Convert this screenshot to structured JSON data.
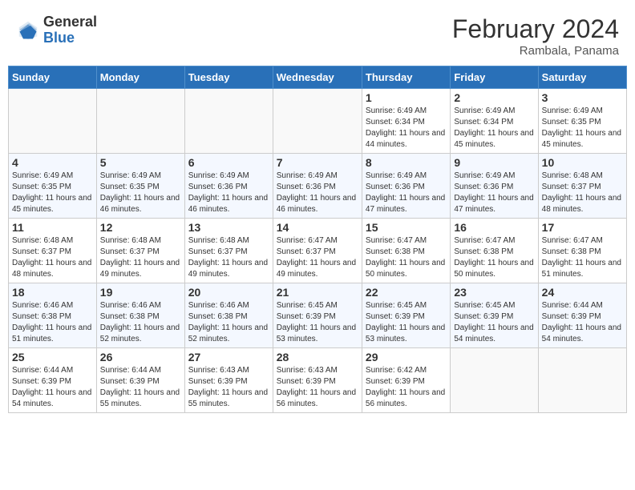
{
  "header": {
    "logo_general": "General",
    "logo_blue": "Blue",
    "month_title": "February 2024",
    "subtitle": "Rambala, Panama"
  },
  "days_of_week": [
    "Sunday",
    "Monday",
    "Tuesday",
    "Wednesday",
    "Thursday",
    "Friday",
    "Saturday"
  ],
  "weeks": [
    [
      {
        "day": "",
        "info": ""
      },
      {
        "day": "",
        "info": ""
      },
      {
        "day": "",
        "info": ""
      },
      {
        "day": "",
        "info": ""
      },
      {
        "day": "1",
        "info": "Sunrise: 6:49 AM\nSunset: 6:34 PM\nDaylight: 11 hours and 44 minutes."
      },
      {
        "day": "2",
        "info": "Sunrise: 6:49 AM\nSunset: 6:34 PM\nDaylight: 11 hours and 45 minutes."
      },
      {
        "day": "3",
        "info": "Sunrise: 6:49 AM\nSunset: 6:35 PM\nDaylight: 11 hours and 45 minutes."
      }
    ],
    [
      {
        "day": "4",
        "info": "Sunrise: 6:49 AM\nSunset: 6:35 PM\nDaylight: 11 hours and 45 minutes."
      },
      {
        "day": "5",
        "info": "Sunrise: 6:49 AM\nSunset: 6:35 PM\nDaylight: 11 hours and 46 minutes."
      },
      {
        "day": "6",
        "info": "Sunrise: 6:49 AM\nSunset: 6:36 PM\nDaylight: 11 hours and 46 minutes."
      },
      {
        "day": "7",
        "info": "Sunrise: 6:49 AM\nSunset: 6:36 PM\nDaylight: 11 hours and 46 minutes."
      },
      {
        "day": "8",
        "info": "Sunrise: 6:49 AM\nSunset: 6:36 PM\nDaylight: 11 hours and 47 minutes."
      },
      {
        "day": "9",
        "info": "Sunrise: 6:49 AM\nSunset: 6:36 PM\nDaylight: 11 hours and 47 minutes."
      },
      {
        "day": "10",
        "info": "Sunrise: 6:48 AM\nSunset: 6:37 PM\nDaylight: 11 hours and 48 minutes."
      }
    ],
    [
      {
        "day": "11",
        "info": "Sunrise: 6:48 AM\nSunset: 6:37 PM\nDaylight: 11 hours and 48 minutes."
      },
      {
        "day": "12",
        "info": "Sunrise: 6:48 AM\nSunset: 6:37 PM\nDaylight: 11 hours and 49 minutes."
      },
      {
        "day": "13",
        "info": "Sunrise: 6:48 AM\nSunset: 6:37 PM\nDaylight: 11 hours and 49 minutes."
      },
      {
        "day": "14",
        "info": "Sunrise: 6:47 AM\nSunset: 6:37 PM\nDaylight: 11 hours and 49 minutes."
      },
      {
        "day": "15",
        "info": "Sunrise: 6:47 AM\nSunset: 6:38 PM\nDaylight: 11 hours and 50 minutes."
      },
      {
        "day": "16",
        "info": "Sunrise: 6:47 AM\nSunset: 6:38 PM\nDaylight: 11 hours and 50 minutes."
      },
      {
        "day": "17",
        "info": "Sunrise: 6:47 AM\nSunset: 6:38 PM\nDaylight: 11 hours and 51 minutes."
      }
    ],
    [
      {
        "day": "18",
        "info": "Sunrise: 6:46 AM\nSunset: 6:38 PM\nDaylight: 11 hours and 51 minutes."
      },
      {
        "day": "19",
        "info": "Sunrise: 6:46 AM\nSunset: 6:38 PM\nDaylight: 11 hours and 52 minutes."
      },
      {
        "day": "20",
        "info": "Sunrise: 6:46 AM\nSunset: 6:38 PM\nDaylight: 11 hours and 52 minutes."
      },
      {
        "day": "21",
        "info": "Sunrise: 6:45 AM\nSunset: 6:39 PM\nDaylight: 11 hours and 53 minutes."
      },
      {
        "day": "22",
        "info": "Sunrise: 6:45 AM\nSunset: 6:39 PM\nDaylight: 11 hours and 53 minutes."
      },
      {
        "day": "23",
        "info": "Sunrise: 6:45 AM\nSunset: 6:39 PM\nDaylight: 11 hours and 54 minutes."
      },
      {
        "day": "24",
        "info": "Sunrise: 6:44 AM\nSunset: 6:39 PM\nDaylight: 11 hours and 54 minutes."
      }
    ],
    [
      {
        "day": "25",
        "info": "Sunrise: 6:44 AM\nSunset: 6:39 PM\nDaylight: 11 hours and 54 minutes."
      },
      {
        "day": "26",
        "info": "Sunrise: 6:44 AM\nSunset: 6:39 PM\nDaylight: 11 hours and 55 minutes."
      },
      {
        "day": "27",
        "info": "Sunrise: 6:43 AM\nSunset: 6:39 PM\nDaylight: 11 hours and 55 minutes."
      },
      {
        "day": "28",
        "info": "Sunrise: 6:43 AM\nSunset: 6:39 PM\nDaylight: 11 hours and 56 minutes."
      },
      {
        "day": "29",
        "info": "Sunrise: 6:42 AM\nSunset: 6:39 PM\nDaylight: 11 hours and 56 minutes."
      },
      {
        "day": "",
        "info": ""
      },
      {
        "day": "",
        "info": ""
      }
    ]
  ]
}
